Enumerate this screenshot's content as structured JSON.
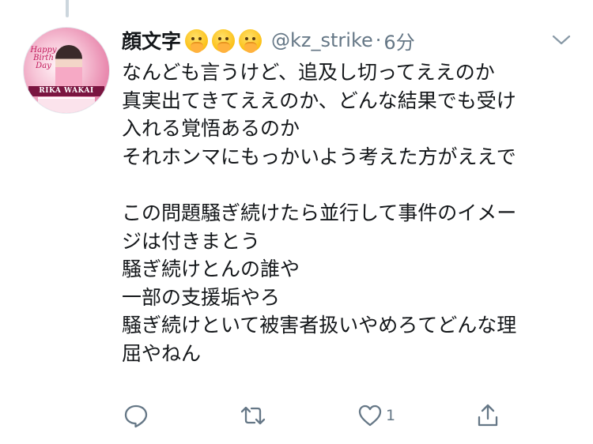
{
  "tweet": {
    "display_name": "顔文字",
    "name_emojis": [
      "face-with-hand-over-mouth-icon",
      "face-with-hand-over-mouth-icon",
      "face-with-hand-over-mouth-icon"
    ],
    "handle": "@kz_strike",
    "separator": "·",
    "time": "6分",
    "text": "なんども言うけど、追及し切ってええのか\n真実出てきてええのか、どんな結果でも受け\n入れる覚悟あるのか\nそれホンマにもっかいよう考えた方がええで\n\nこの問題騒ぎ続けたら並行して事件のイメー\nジは付きまとう\n騒ぎ続けとんの誰や\n一部の支援垢やろ\n騒ぎ続けといて被害者扱いやめろてどんな理\n屈やねん",
    "avatar": {
      "label_text": "Happy Birth Day",
      "banner_text": "RIKA WAKAI"
    }
  },
  "actions": {
    "reply": {
      "icon": "reply-icon"
    },
    "retweet": {
      "icon": "retweet-icon"
    },
    "like": {
      "icon": "heart-icon",
      "count": "1"
    },
    "share": {
      "icon": "share-icon"
    }
  },
  "colors": {
    "text": "#14171a",
    "secondary": "#657786",
    "thread_line": "#ccd6dd",
    "background": "#ffffff"
  }
}
